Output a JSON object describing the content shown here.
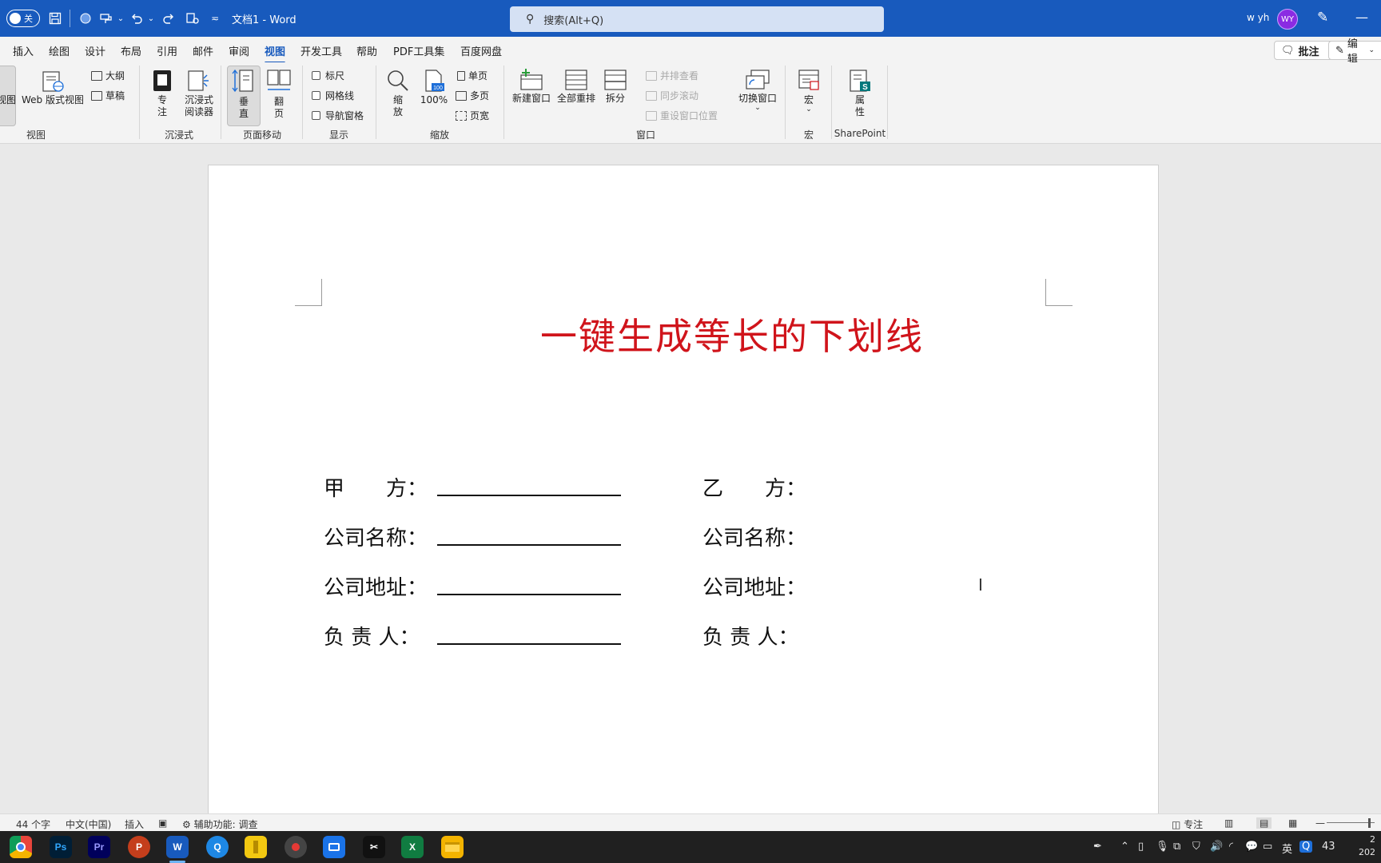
{
  "titlebar": {
    "autosave_label": "关",
    "title": "文档1  -  Word",
    "search_placeholder": "搜索(Alt+Q)",
    "user_name": "w yh",
    "avatar_initials": "WY"
  },
  "menu": {
    "tabs": [
      "插入",
      "绘图",
      "设计",
      "布局",
      "引用",
      "邮件",
      "审阅",
      "视图",
      "开发工具",
      "帮助",
      "PDF工具集",
      "百度网盘"
    ],
    "active_tab": "视图",
    "comment_button": "批注",
    "edit_button": "编辑"
  },
  "ribbon": {
    "views": {
      "label": "视图",
      "read_partial": "视图",
      "web_layout": "Web 版式视图",
      "outline": "大纲",
      "draft": "草稿"
    },
    "immersive": {
      "label": "沉浸式",
      "focus": "专\n注",
      "immersive_reader": "沉浸式\n阅读器"
    },
    "page_movement": {
      "label": "页面移动",
      "vertical": "垂\n直",
      "side_to_side": "翻\n页"
    },
    "show": {
      "label": "显示",
      "ruler": "标尺",
      "gridlines": "网格线",
      "navigation_pane": "导航窗格"
    },
    "zoom": {
      "label": "缩放",
      "zoom": "缩\n放",
      "hundred": "100%",
      "one_page": "单页",
      "multiple_pages": "多页",
      "page_width": "页宽"
    },
    "window": {
      "label": "窗口",
      "new_window": "新建窗口",
      "arrange_all": "全部重排",
      "split": "拆分",
      "side_by_side": "并排查看",
      "sync_scroll": "同步滚动",
      "reset_window": "重设窗口位置",
      "switch_windows": "切换窗口"
    },
    "macros": {
      "label": "宏",
      "macros": "宏"
    },
    "sharepoint": {
      "label": "SharePoint",
      "properties": "属\n性"
    }
  },
  "document": {
    "title": "一键生成等长的下划线",
    "left_fields": [
      "甲　　方：",
      "公司名称：",
      "公司地址：",
      "负 责 人："
    ],
    "right_fields": [
      "乙　　方：",
      "公司名称：",
      "公司地址：",
      "负 责 人："
    ]
  },
  "statusbar": {
    "word_count": "44 个字",
    "language": "中文(中国)",
    "mode": "插入",
    "accessibility": "辅助功能: 调查",
    "focus": "专注"
  },
  "taskbar": {
    "apps": [
      {
        "name": "chrome",
        "label": "",
        "color": "#e8453c"
      },
      {
        "name": "photoshop",
        "label": "Ps",
        "color": "#001e36"
      },
      {
        "name": "premiere",
        "label": "Pr",
        "color": "#00005b"
      },
      {
        "name": "powerpoint",
        "label": "P",
        "color": "#c43e1c"
      },
      {
        "name": "word",
        "label": "W",
        "color": "#185abd"
      },
      {
        "name": "browser",
        "label": "Q",
        "color": "#1e88e5"
      },
      {
        "name": "power-bi",
        "label": "",
        "color": "#f2c811"
      },
      {
        "name": "recorder",
        "label": "",
        "color": "#444444"
      },
      {
        "name": "meeting",
        "label": "",
        "color": "#1a73e8"
      },
      {
        "name": "capcut",
        "label": "✂",
        "color": "#111111"
      },
      {
        "name": "excel",
        "label": "X",
        "color": "#107c41"
      },
      {
        "name": "file-explorer",
        "label": "",
        "color": "#f4b400"
      }
    ],
    "ime": "英",
    "tray_number": "43",
    "clock_partial": "2",
    "date_partial": "202"
  }
}
